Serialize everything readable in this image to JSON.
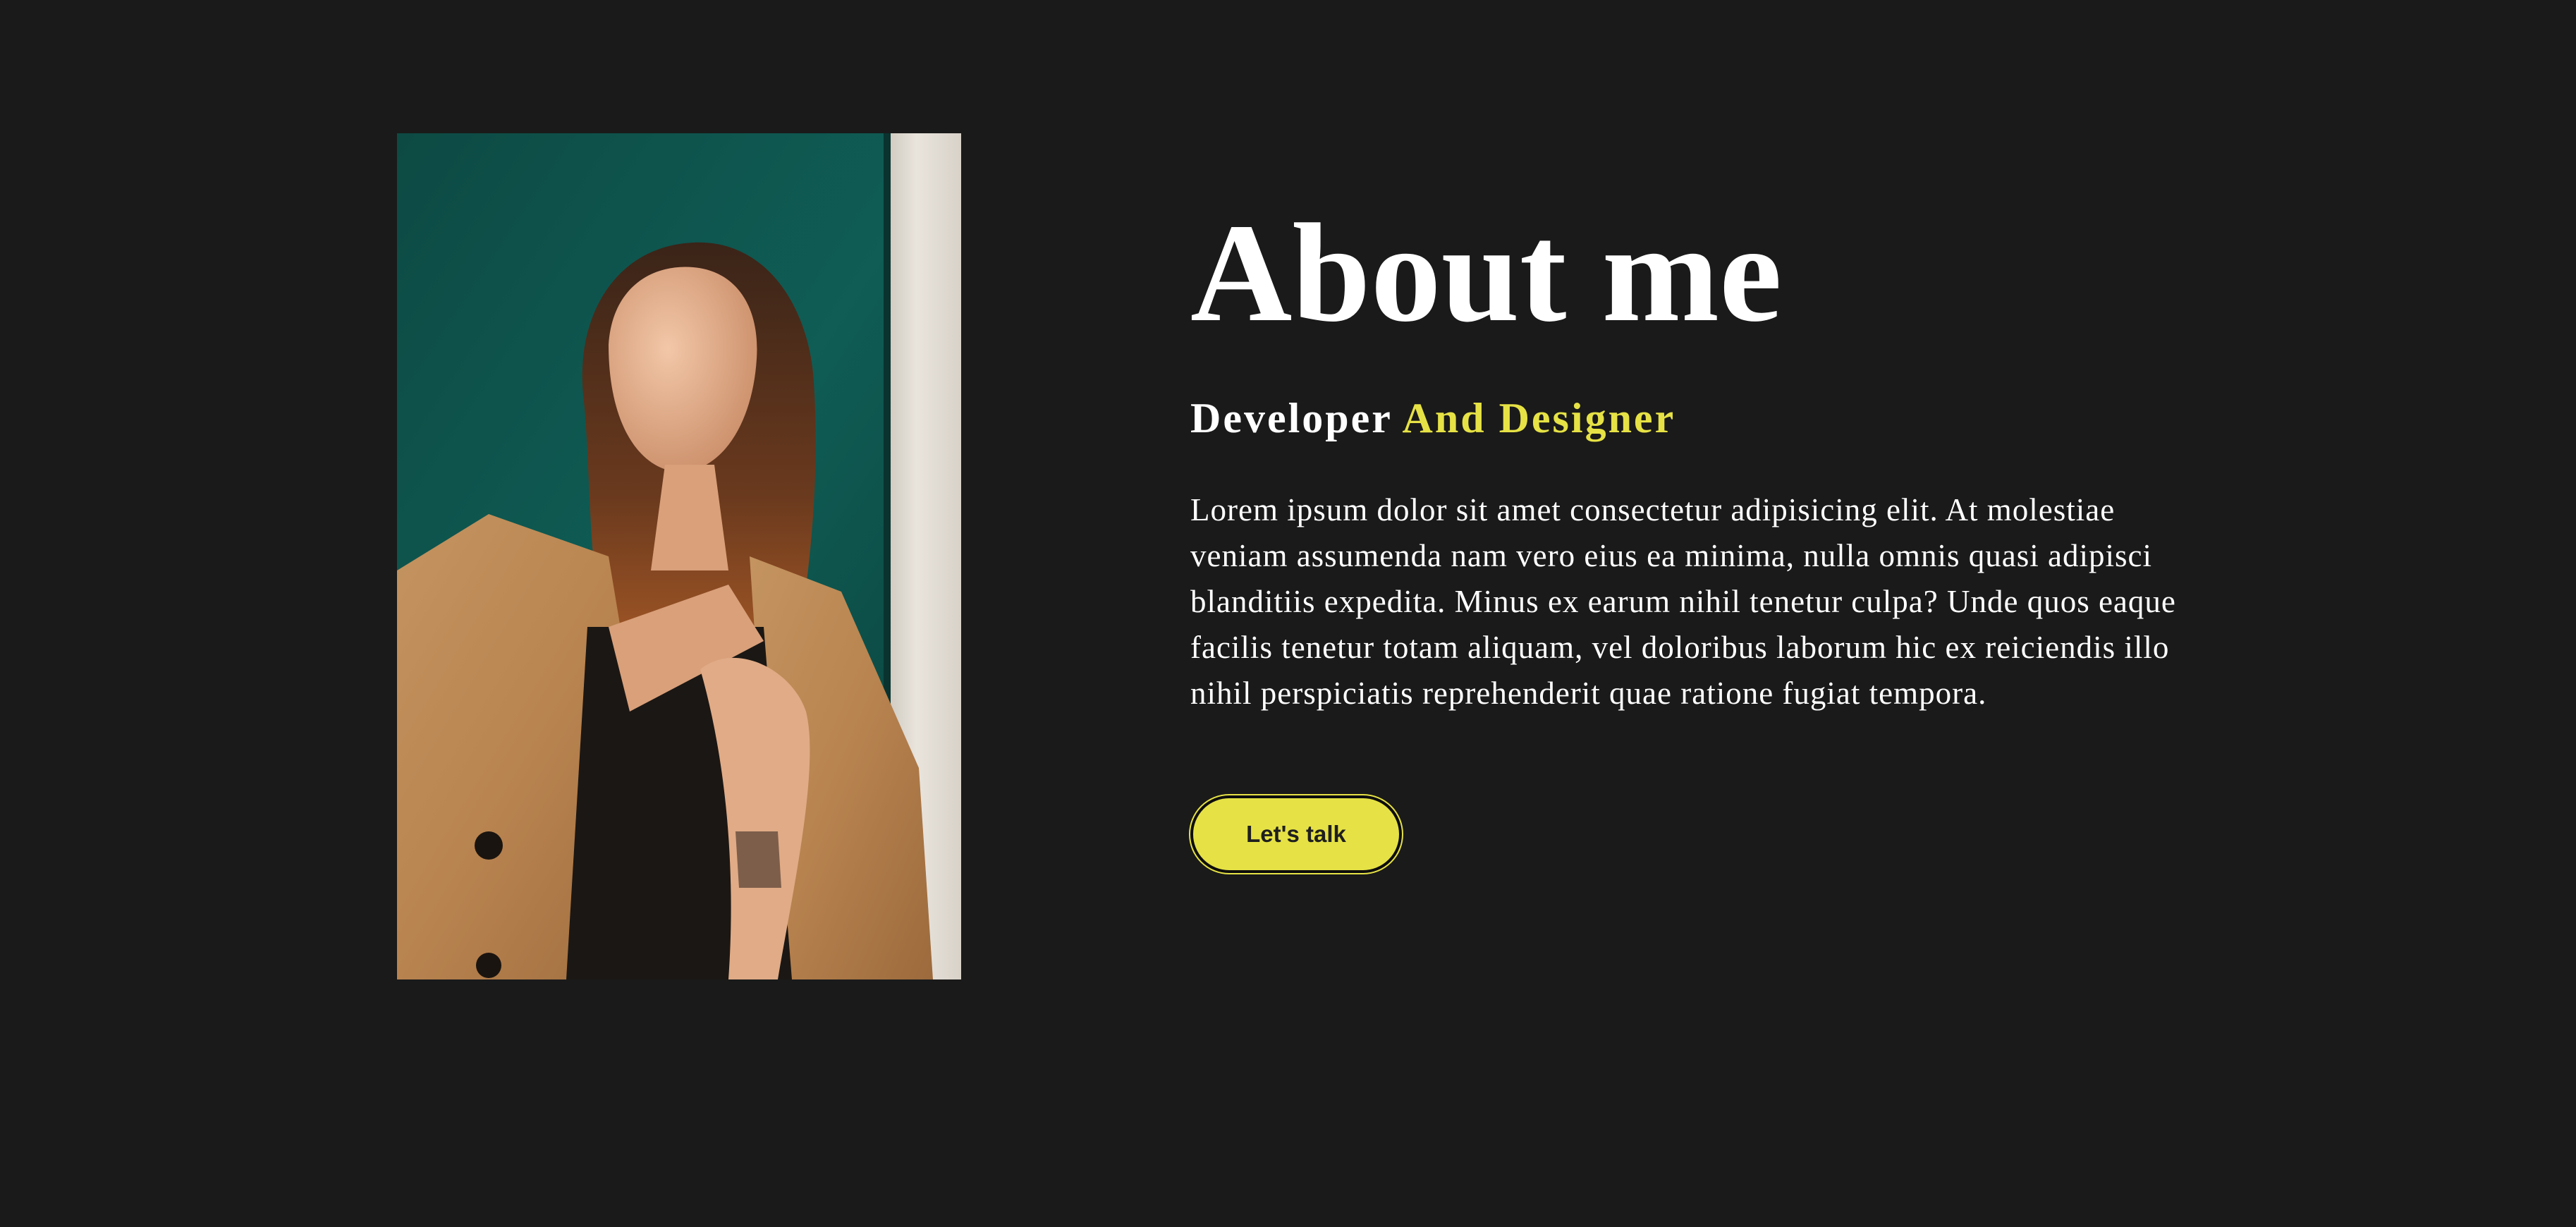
{
  "about": {
    "title": "About me",
    "subtitle": {
      "primary": "Developer",
      "accent": "And Designer"
    },
    "description": "Lorem ipsum dolor sit amet consectetur adipisicing elit. At molestiae veniam assumenda nam vero eius ea minima, nulla omnis quasi adipisci blanditiis expedita. Minus ex earum nihil tenetur culpa? Unde quos eaque facilis tenetur totam aliquam, vel doloribus laborum hic ex reiciendis illo nihil perspiciatis reprehenderit quae ratione fugiat tempora.",
    "cta_label": "Let's talk"
  },
  "colors": {
    "background": "#1a1a1a",
    "accent": "#e6e245",
    "text": "#ffffff"
  }
}
